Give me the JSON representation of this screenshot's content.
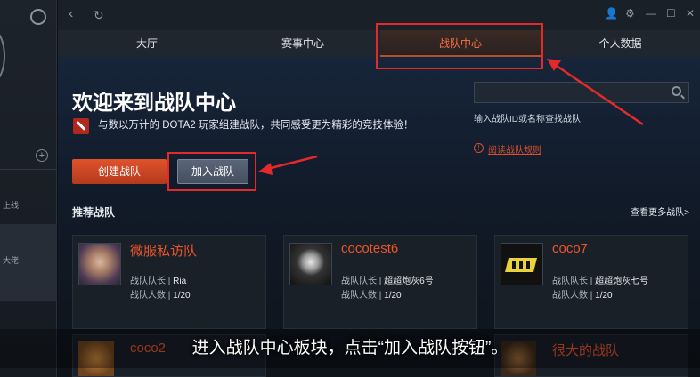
{
  "window": {
    "nav_back": "‹",
    "nav_refresh": "↻",
    "controls": [
      "👤",
      "⚙",
      "—",
      "☐",
      "✕"
    ]
  },
  "leftbar": {
    "plus": "+",
    "items": [
      {
        "label": "上线"
      },
      {
        "label": "大佬"
      }
    ]
  },
  "tabs": [
    {
      "label": "大厅"
    },
    {
      "label": "赛事中心"
    },
    {
      "label": "战队中心",
      "active": true
    },
    {
      "label": "个人数据"
    }
  ],
  "welcome": {
    "title": "欢迎来到战队中心",
    "desc": "与数以万计的 DOTA2 玩家组建战队，共同感受更为精彩的竞技体验！",
    "create_button": "创建战队",
    "join_button": "加入战队"
  },
  "search": {
    "value": "",
    "hint": "输入战队ID或名称查找战队",
    "rules_icon": "!",
    "rules_link": "阅读战队规则"
  },
  "recommended": {
    "title": "推荐战队",
    "more": "查看更多战队>",
    "cards": [
      {
        "name": "微服私访队",
        "captain_label": "战队队长",
        "captain": "Ria",
        "members_label": "战队人数",
        "members": "1/20"
      },
      {
        "name": "cocotest6",
        "captain_label": "战队队长",
        "captain": "超超炮灰6号",
        "members_label": "战队人数",
        "members": "1/20"
      },
      {
        "name": "coco7",
        "captain_label": "战队队长",
        "captain": "超超炮灰七号",
        "members_label": "战队人数",
        "members": "1/20"
      }
    ],
    "partial_cards": [
      {
        "name": "coco2"
      },
      {
        "name": "很大的战队"
      }
    ]
  },
  "caption": "进入战队中心板块，点击“加入战队按钮”。",
  "colors": {
    "accent": "#e8542c",
    "annotation": "#e32a2a"
  }
}
